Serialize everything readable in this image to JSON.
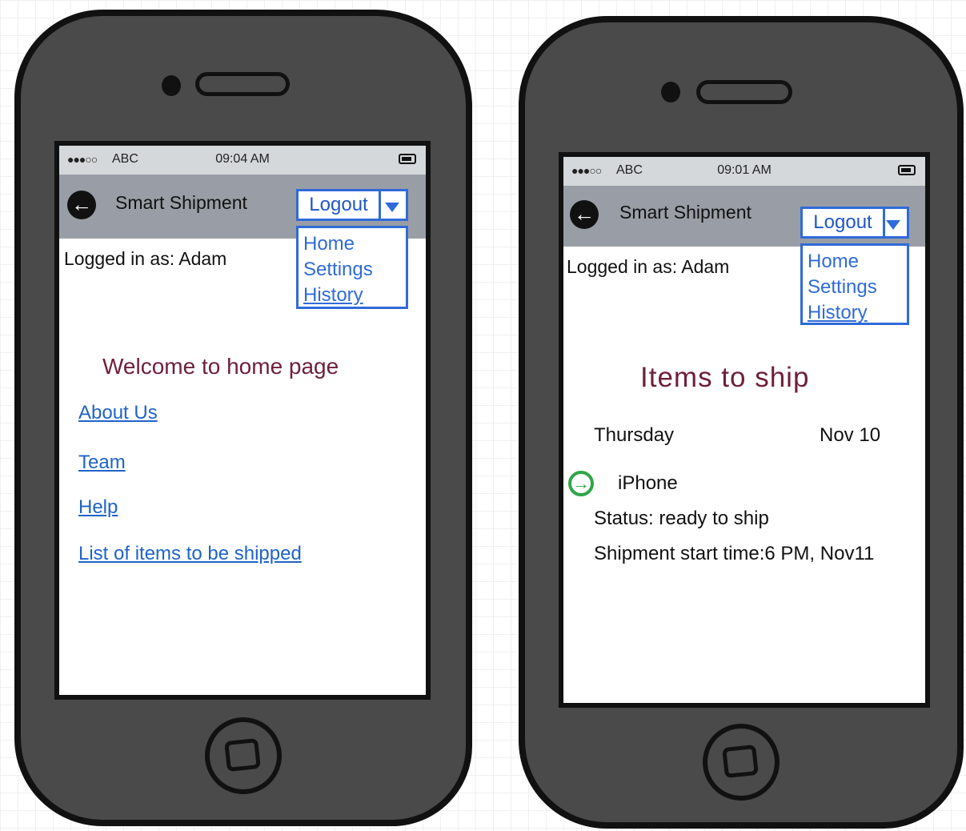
{
  "mockup_left": {
    "status": {
      "signal": "●●●○○",
      "carrier": "ABC",
      "time": "09:04 AM"
    },
    "header": {
      "title": "Smart Shipment",
      "logout_label": "Logout"
    },
    "menu": [
      "Home",
      "Settings",
      "History"
    ],
    "logged_in": "Logged in as: Adam",
    "welcome": "Welcome to home page",
    "links": [
      "About Us",
      "Team",
      "Help",
      "List of items to be shipped"
    ]
  },
  "mockup_right": {
    "status": {
      "signal": "●●●○○",
      "carrier": "ABC",
      "time": "09:01 AM"
    },
    "header": {
      "title": "Smart Shipment",
      "logout_label": "Logout"
    },
    "menu": [
      "Home",
      "Settings",
      "History"
    ],
    "logged_in": "Logged in as: Adam",
    "heading": "Items to ship",
    "day": "Thursday",
    "date": "Nov 10",
    "item_name": "iPhone",
    "status_line": "Status: ready to ship",
    "shipment_line": "Shipment start time:6 PM, Nov11"
  },
  "icons": {
    "back": "back-arrow-circle-icon",
    "dropdown": "triangle-down-icon",
    "item": "arrow-right-circle-icon",
    "battery": "battery-icon"
  },
  "colors": {
    "link_blue": "#1f63c8",
    "menu_blue": "#2f6bd8",
    "heading_maroon": "#6e1f3b",
    "navbar_gray": "#999ea6",
    "go_green": "#2fa64b"
  }
}
